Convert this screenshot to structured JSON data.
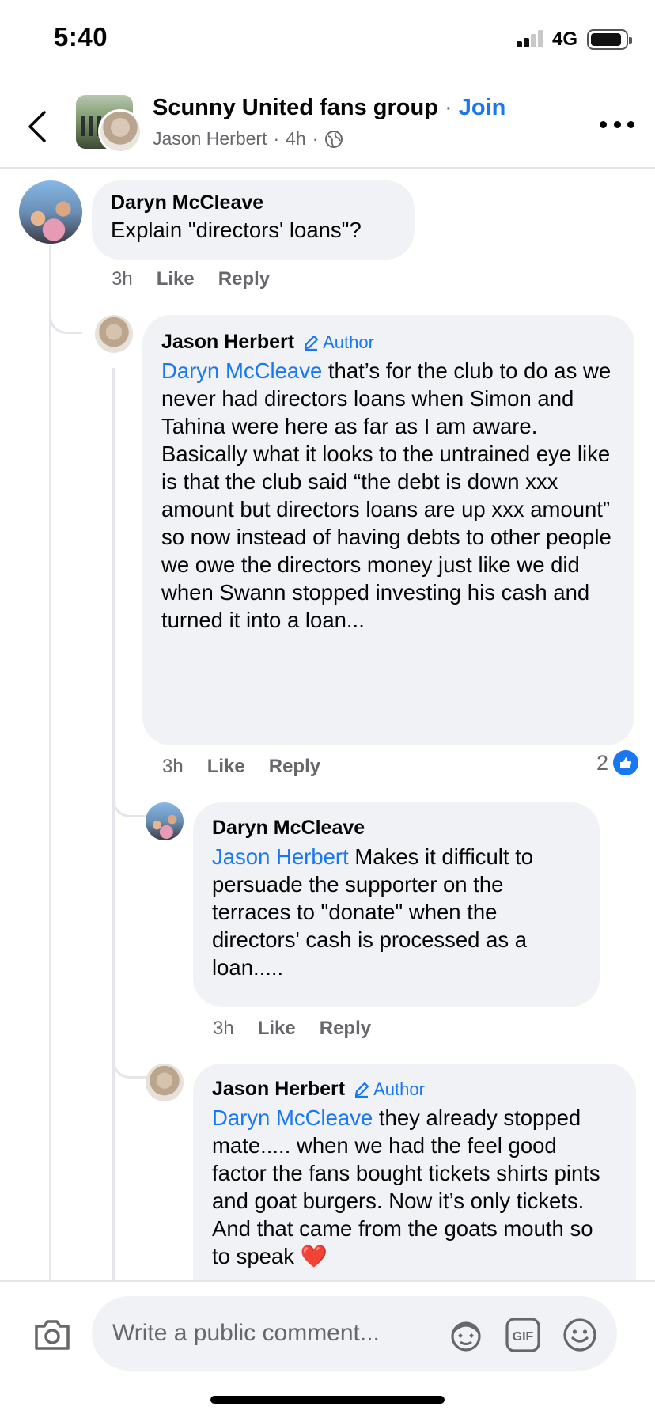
{
  "status_bar": {
    "time": "5:40",
    "network": "4G"
  },
  "header": {
    "group_name": "Scunny United fans group",
    "separator": "·",
    "join_label": "Join",
    "author": "Jason Herbert",
    "time_ago": "4h",
    "privacy_icon": "globe-icon"
  },
  "comments": [
    {
      "author": "Daryn McCleave",
      "text": "Explain \"directors' loans\"?",
      "time": "3h",
      "like_label": "Like",
      "reply_label": "Reply"
    },
    {
      "author": "Jason Herbert",
      "badge": "Author",
      "mention": "Daryn McCleave",
      "text_1": " that’s for the club to do as we never had directors loans when Simon and Tahina were here as far as I am aware.",
      "text_2": "Basically what it looks to the untrained eye like is that the club said “the debt is down xxx amount but directors loans are up xxx amount” so now instead of having debts to other people we owe the directors money just like we did when Swann stopped investing his cash and turned it into a loan...",
      "time": "3h",
      "like_label": "Like",
      "reply_label": "Reply",
      "reaction_count": "2"
    },
    {
      "author": "Daryn McCleave",
      "mention": "Jason Herbert",
      "text": " Makes it difficult to persuade the supporter on the terraces to  \"donate\" when the directors' cash is processed as a loan.....",
      "time": "3h",
      "like_label": "Like",
      "reply_label": "Reply"
    },
    {
      "author": "Jason Herbert",
      "badge": "Author",
      "mention": "Daryn McCleave",
      "text": " they already stopped mate..... when we had the feel good factor the fans bought tickets shirts pints and goat burgers. Now it’s only tickets. And that came from the goats mouth so to speak ",
      "emoji": "❤️"
    }
  ],
  "composer": {
    "placeholder": "Write a public comment..."
  },
  "colors": {
    "accent": "#1877f2",
    "bubble": "#f0f2f5",
    "secondary_text": "#65676b"
  }
}
